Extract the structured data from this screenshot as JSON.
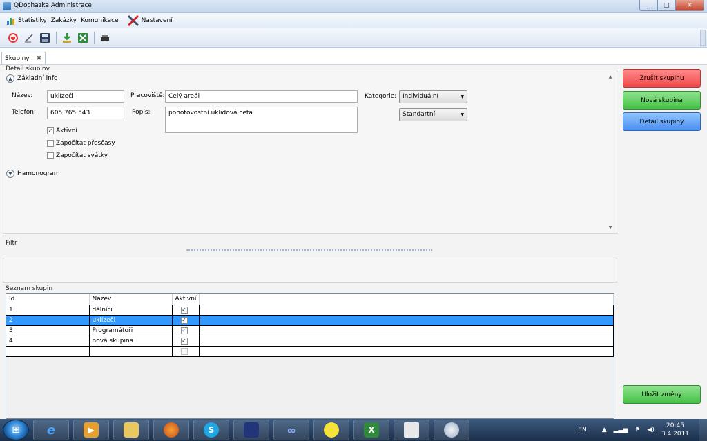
{
  "window": {
    "title": "QDochazka Administrace",
    "buttons": {
      "minimize": "_",
      "maximize": "□",
      "close": "✕"
    }
  },
  "menu": {
    "items": [
      {
        "label": "Statistiky",
        "icon": "chart-icon"
      },
      {
        "label": "Zakázky"
      },
      {
        "label": "Komunikace"
      },
      {
        "label": "Nastavení",
        "icon": "tools-icon"
      }
    ]
  },
  "toolbar": {
    "icons": [
      "power-icon",
      "edit-icon",
      "save-icon",
      "import-icon",
      "excel-icon",
      "print-icon"
    ]
  },
  "tabs": [
    {
      "label": "Skupiny",
      "close": "✖"
    }
  ],
  "detail": {
    "group_label": "Detail skupiny",
    "basic_info_label": "Základní info",
    "nazev_label": "Název:",
    "nazev_value": "uklízeči",
    "telefon_label": "Telefon:",
    "telefon_value": "605 765 543",
    "pracoviste_label": "Pracoviště:",
    "pracoviste_value": "Celý areál",
    "popis_label": "Popis:",
    "popis_value": "pohotovostní úklidová ceta",
    "kategorie_label": "Kategorie:",
    "kategorie_value": "Individuální",
    "type_value": "Standartní",
    "checkboxes": [
      {
        "label": "Aktivní",
        "checked": true
      },
      {
        "label": "Započítat přesčasy",
        "checked": false
      },
      {
        "label": "Započítat svátky",
        "checked": false
      }
    ],
    "hamonogram_label": "Hamonogram"
  },
  "filter": {
    "label": "Filtr"
  },
  "list": {
    "label": "Seznam skupin",
    "columns": [
      "Id",
      "Název",
      "Aktivní"
    ],
    "rows": [
      {
        "id": "1",
        "name": "dělníci",
        "active": true
      },
      {
        "id": "2",
        "name": "uklízeči",
        "active": true,
        "selected": true
      },
      {
        "id": "3",
        "name": "Programátoři",
        "active": true
      },
      {
        "id": "4",
        "name": "nová skupina",
        "active": true
      },
      {
        "id": "",
        "name": "",
        "active": false,
        "new_row": true
      }
    ]
  },
  "actions": {
    "zrusit": "Zrušit skupinu",
    "nova": "Nová skupina",
    "detail": "Detail skupiny",
    "ulozit": "Uložit změny"
  },
  "colors": {
    "red": "#f04949",
    "green": "#45c145",
    "blue": "#4b8ff0",
    "selection": "#3399ff"
  },
  "taskbar": {
    "apps": [
      "ie-icon",
      "media-player-icon",
      "explorer-icon",
      "firefox-icon",
      "skype-icon",
      "save-disk-icon",
      "infinity-icon",
      "duck-icon",
      "excel-icon",
      "notepad-icon",
      "paint-icon"
    ],
    "lang": "EN",
    "time": "20:45",
    "date": "3.4.2011"
  }
}
